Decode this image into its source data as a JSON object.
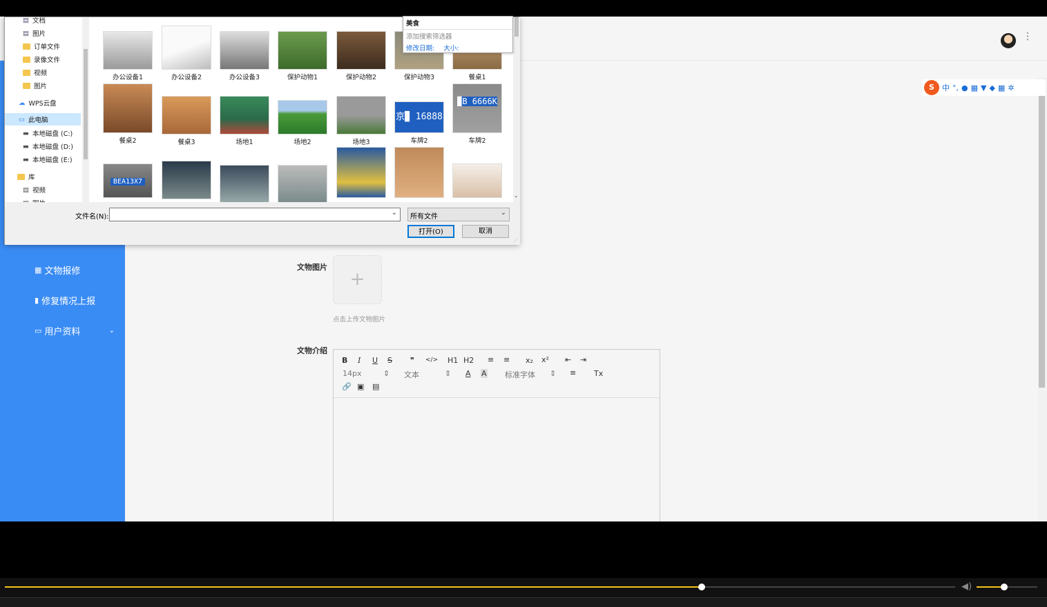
{
  "sidebar": {
    "items": [
      {
        "label": "文物报修",
        "icon": "grid-icon"
      },
      {
        "label": "修复情况上报",
        "icon": "chat-icon"
      },
      {
        "label": "用户资料",
        "icon": "folder-icon"
      }
    ]
  },
  "form": {
    "image_label": "文物图片",
    "upload_plus": "+",
    "upload_hint": "点击上传文物图片",
    "intro_label": "文物介绍"
  },
  "editor": {
    "bold": "B",
    "italic": "I",
    "underline": "U",
    "strike": "S",
    "quote": "❞",
    "code": "</>",
    "h1": "H1",
    "h2": "H2",
    "ol": "≡",
    "ul": "≡",
    "sub": "x₂",
    "sup": "x²",
    "outdent": "⇤",
    "indent": "⇥",
    "font_size": "14px",
    "block_type": "文本",
    "font_family": "标准字体",
    "font_color": "A",
    "bg_color": "A",
    "align": "≡",
    "clear": "Tx"
  },
  "dialog": {
    "nav": [
      {
        "label": "文档",
        "icon": "doc-icon"
      },
      {
        "label": "图片",
        "icon": "pictures-icon"
      },
      {
        "label": "订单文件",
        "icon": "folder-icon"
      },
      {
        "label": "录像文件",
        "icon": "folder-icon"
      },
      {
        "label": "视频",
        "icon": "folder-icon"
      },
      {
        "label": "图片",
        "icon": "folder-icon"
      },
      {
        "label": "WPS云盘",
        "icon": "cloud-icon"
      },
      {
        "label": "此电脑",
        "icon": "computer-icon"
      },
      {
        "label": "本地磁盘 (C:)",
        "icon": "drive-icon"
      },
      {
        "label": "本地磁盘 (D:)",
        "icon": "drive-icon"
      },
      {
        "label": "本地磁盘 (E:)",
        "icon": "drive-icon"
      },
      {
        "label": "库",
        "icon": "library-icon"
      },
      {
        "label": "视频",
        "icon": "video-icon"
      },
      {
        "label": "图片",
        "icon": "pictures-icon"
      }
    ],
    "files_row1": [
      "办公设备1",
      "办公设备2",
      "办公设备3",
      "保护动物1",
      "保护动物2",
      "保护动物3",
      "餐桌1"
    ],
    "files_row2": [
      "餐桌2",
      "餐桌3",
      "场地1",
      "场地2",
      "场地3",
      "车牌2",
      "车牌2"
    ],
    "files_row3": [
      "",
      "",
      "",
      "",
      "",
      "",
      ""
    ],
    "plate_text_1": "京▉ 16888",
    "plate_text_2": "▉B 6666K",
    "plate_text_3": "BEA13X7",
    "search_dropdown": {
      "query": "美食",
      "add_filter": "添加搜索筛选器",
      "filter_date": "修改日期:",
      "filter_size": "大小:"
    },
    "filename_label": "文件名(N):",
    "filename_value": "",
    "filetype": "所有文件",
    "open_button": "打开(O)",
    "cancel_button": "取消"
  },
  "ime": {
    "logo": "S",
    "items": [
      "中",
      "°,",
      "🎤",
      "⌨",
      "👕",
      "🎮",
      "▦",
      "⚙"
    ]
  },
  "colors": {
    "sidebar": "#3a8cf5",
    "progress": "#f5c518"
  },
  "player": {
    "progress": 0.733,
    "volume": 0.45
  }
}
